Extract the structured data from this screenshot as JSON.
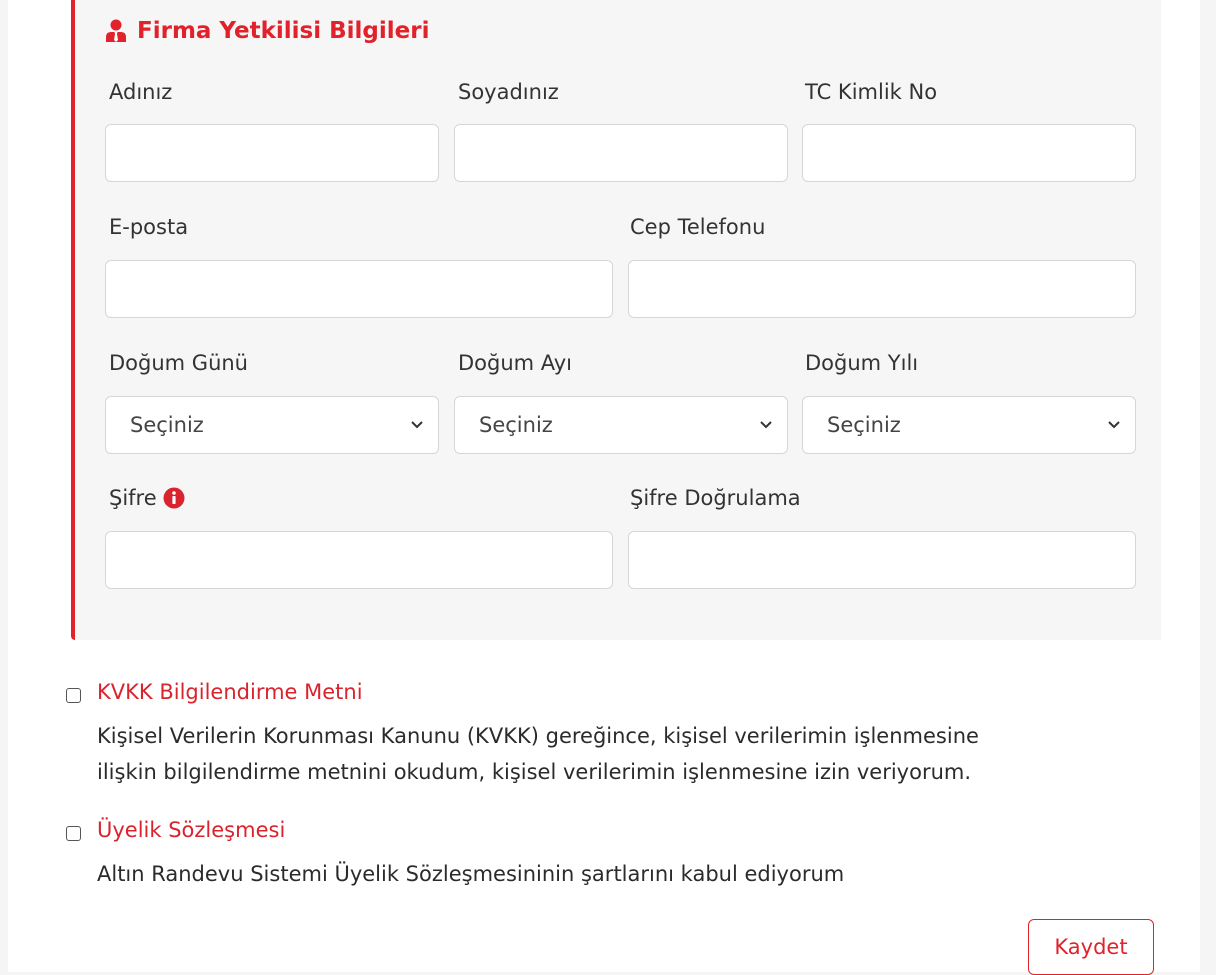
{
  "section": {
    "title": "Firma Yetkilisi Bilgileri",
    "icon": "user-tie-icon",
    "accent_color": "#e2222a"
  },
  "fields": {
    "first_name": {
      "label": "Adınız",
      "value": ""
    },
    "last_name": {
      "label": "Soyadınız",
      "value": ""
    },
    "tc_no": {
      "label": "TC Kimlik No",
      "value": ""
    },
    "email": {
      "label": "E-posta",
      "value": ""
    },
    "phone": {
      "label": "Cep Telefonu",
      "value": ""
    },
    "birth_day": {
      "label": "Doğum Günü",
      "selected": "Seçiniz"
    },
    "birth_month": {
      "label": "Doğum Ayı",
      "selected": "Seçiniz"
    },
    "birth_year": {
      "label": "Doğum Yılı",
      "selected": "Seçiniz"
    },
    "password": {
      "label": "Şifre",
      "value": "",
      "info_icon": "info-circle-icon"
    },
    "password_confirm": {
      "label": "Şifre Doğrulama",
      "value": ""
    }
  },
  "agreements": {
    "kvkk": {
      "title": "KVKK Bilgilendirme Metni",
      "text_line1": "Kişisel Verilerin Korunması Kanunu (KVKK) gereğince, kişisel verilerimin işlenmesine",
      "text_line2": "ilişkin bilgilendirme metnini okudum, kişisel verilerimin işlenmesine izin veriyorum.",
      "checked": false
    },
    "membership": {
      "title": "Üyelik Sözleşmesi",
      "text": "Altın Randevu Sistemi Üyelik Sözleşmesininin şartlarını kabul ediyorum",
      "checked": false
    }
  },
  "actions": {
    "save_label": "Kaydet"
  }
}
